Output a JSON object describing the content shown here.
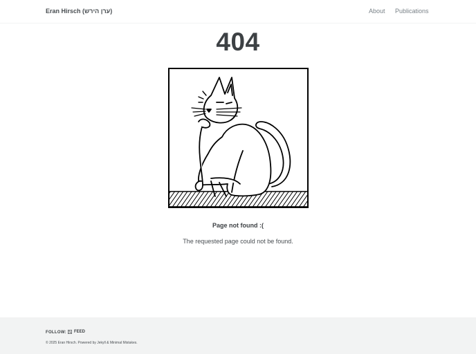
{
  "header": {
    "site_title": "Eran Hirsch (ערן הירש)",
    "nav": [
      {
        "label": "About"
      },
      {
        "label": "Publications"
      }
    ]
  },
  "main": {
    "error_code": "404",
    "title": "Page not found :(",
    "message": "The requested page could not be found."
  },
  "footer": {
    "follow_label": "FOLLOW:",
    "feed_label": "FEED",
    "feed_icon": "rss-icon",
    "copyright": "© 2025 Eran Hirsch. Powered by Jekyll & Minimal Mistakes."
  },
  "colors": {
    "text": "#494e52",
    "heading": "#3d4144",
    "muted": "#7a8288",
    "footer_bg": "#f2f3f3"
  }
}
